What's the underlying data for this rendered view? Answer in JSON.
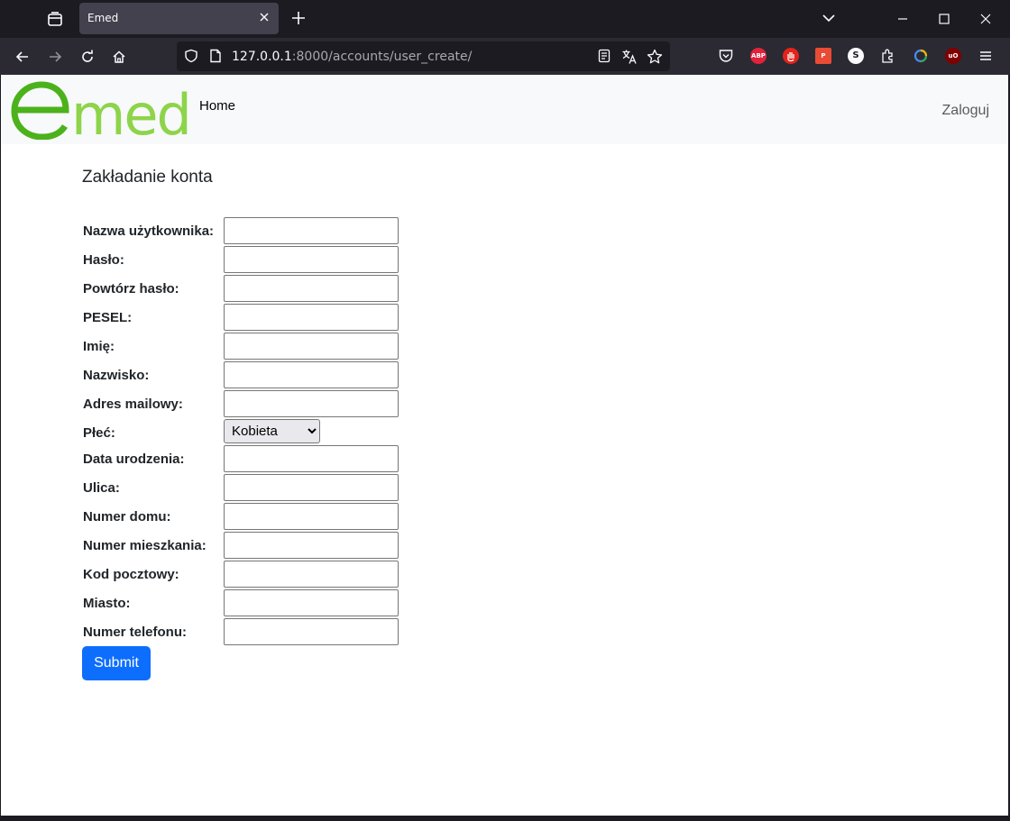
{
  "browser": {
    "tab_title": "Emed",
    "url_host": "127.0.0.1",
    "url_path": ":8000/accounts/user_create/"
  },
  "site": {
    "logo_text": "emed",
    "nav_home": "Home",
    "nav_login": "Zaloguj"
  },
  "page": {
    "title": "Zakładanie konta"
  },
  "form": {
    "fields": [
      {
        "label": "Nazwa użytkownika:",
        "value": ""
      },
      {
        "label": "Hasło:",
        "value": ""
      },
      {
        "label": "Powtórz hasło:",
        "value": ""
      },
      {
        "label": "PESEL:",
        "value": ""
      },
      {
        "label": "Imię:",
        "value": ""
      },
      {
        "label": "Nazwisko:",
        "value": ""
      },
      {
        "label": "Adres mailowy:",
        "value": ""
      },
      {
        "label": "Płeć:",
        "selected": "Kobieta"
      },
      {
        "label": "Data urodzenia:",
        "value": ""
      },
      {
        "label": "Ulica:",
        "value": ""
      },
      {
        "label": "Numer domu:",
        "value": ""
      },
      {
        "label": "Numer mieszkania:",
        "value": ""
      },
      {
        "label": "Kod pocztowy:",
        "value": ""
      },
      {
        "label": "Miasto:",
        "value": ""
      },
      {
        "label": "Numer telefonu:",
        "value": ""
      }
    ],
    "submit_label": "Submit"
  },
  "extensions": [
    "pocket-icon",
    "adblock-plus-icon",
    "stop-hand-icon",
    "pdf-icon",
    "s-icon",
    "extensions-puzzle-icon",
    "color-picker-icon",
    "ublock-origin-icon",
    "menu-icon"
  ],
  "colors": {
    "primary": "#0d6efd",
    "logo_green_dark": "#4cb21b",
    "logo_green_light": "#8dd44a"
  }
}
